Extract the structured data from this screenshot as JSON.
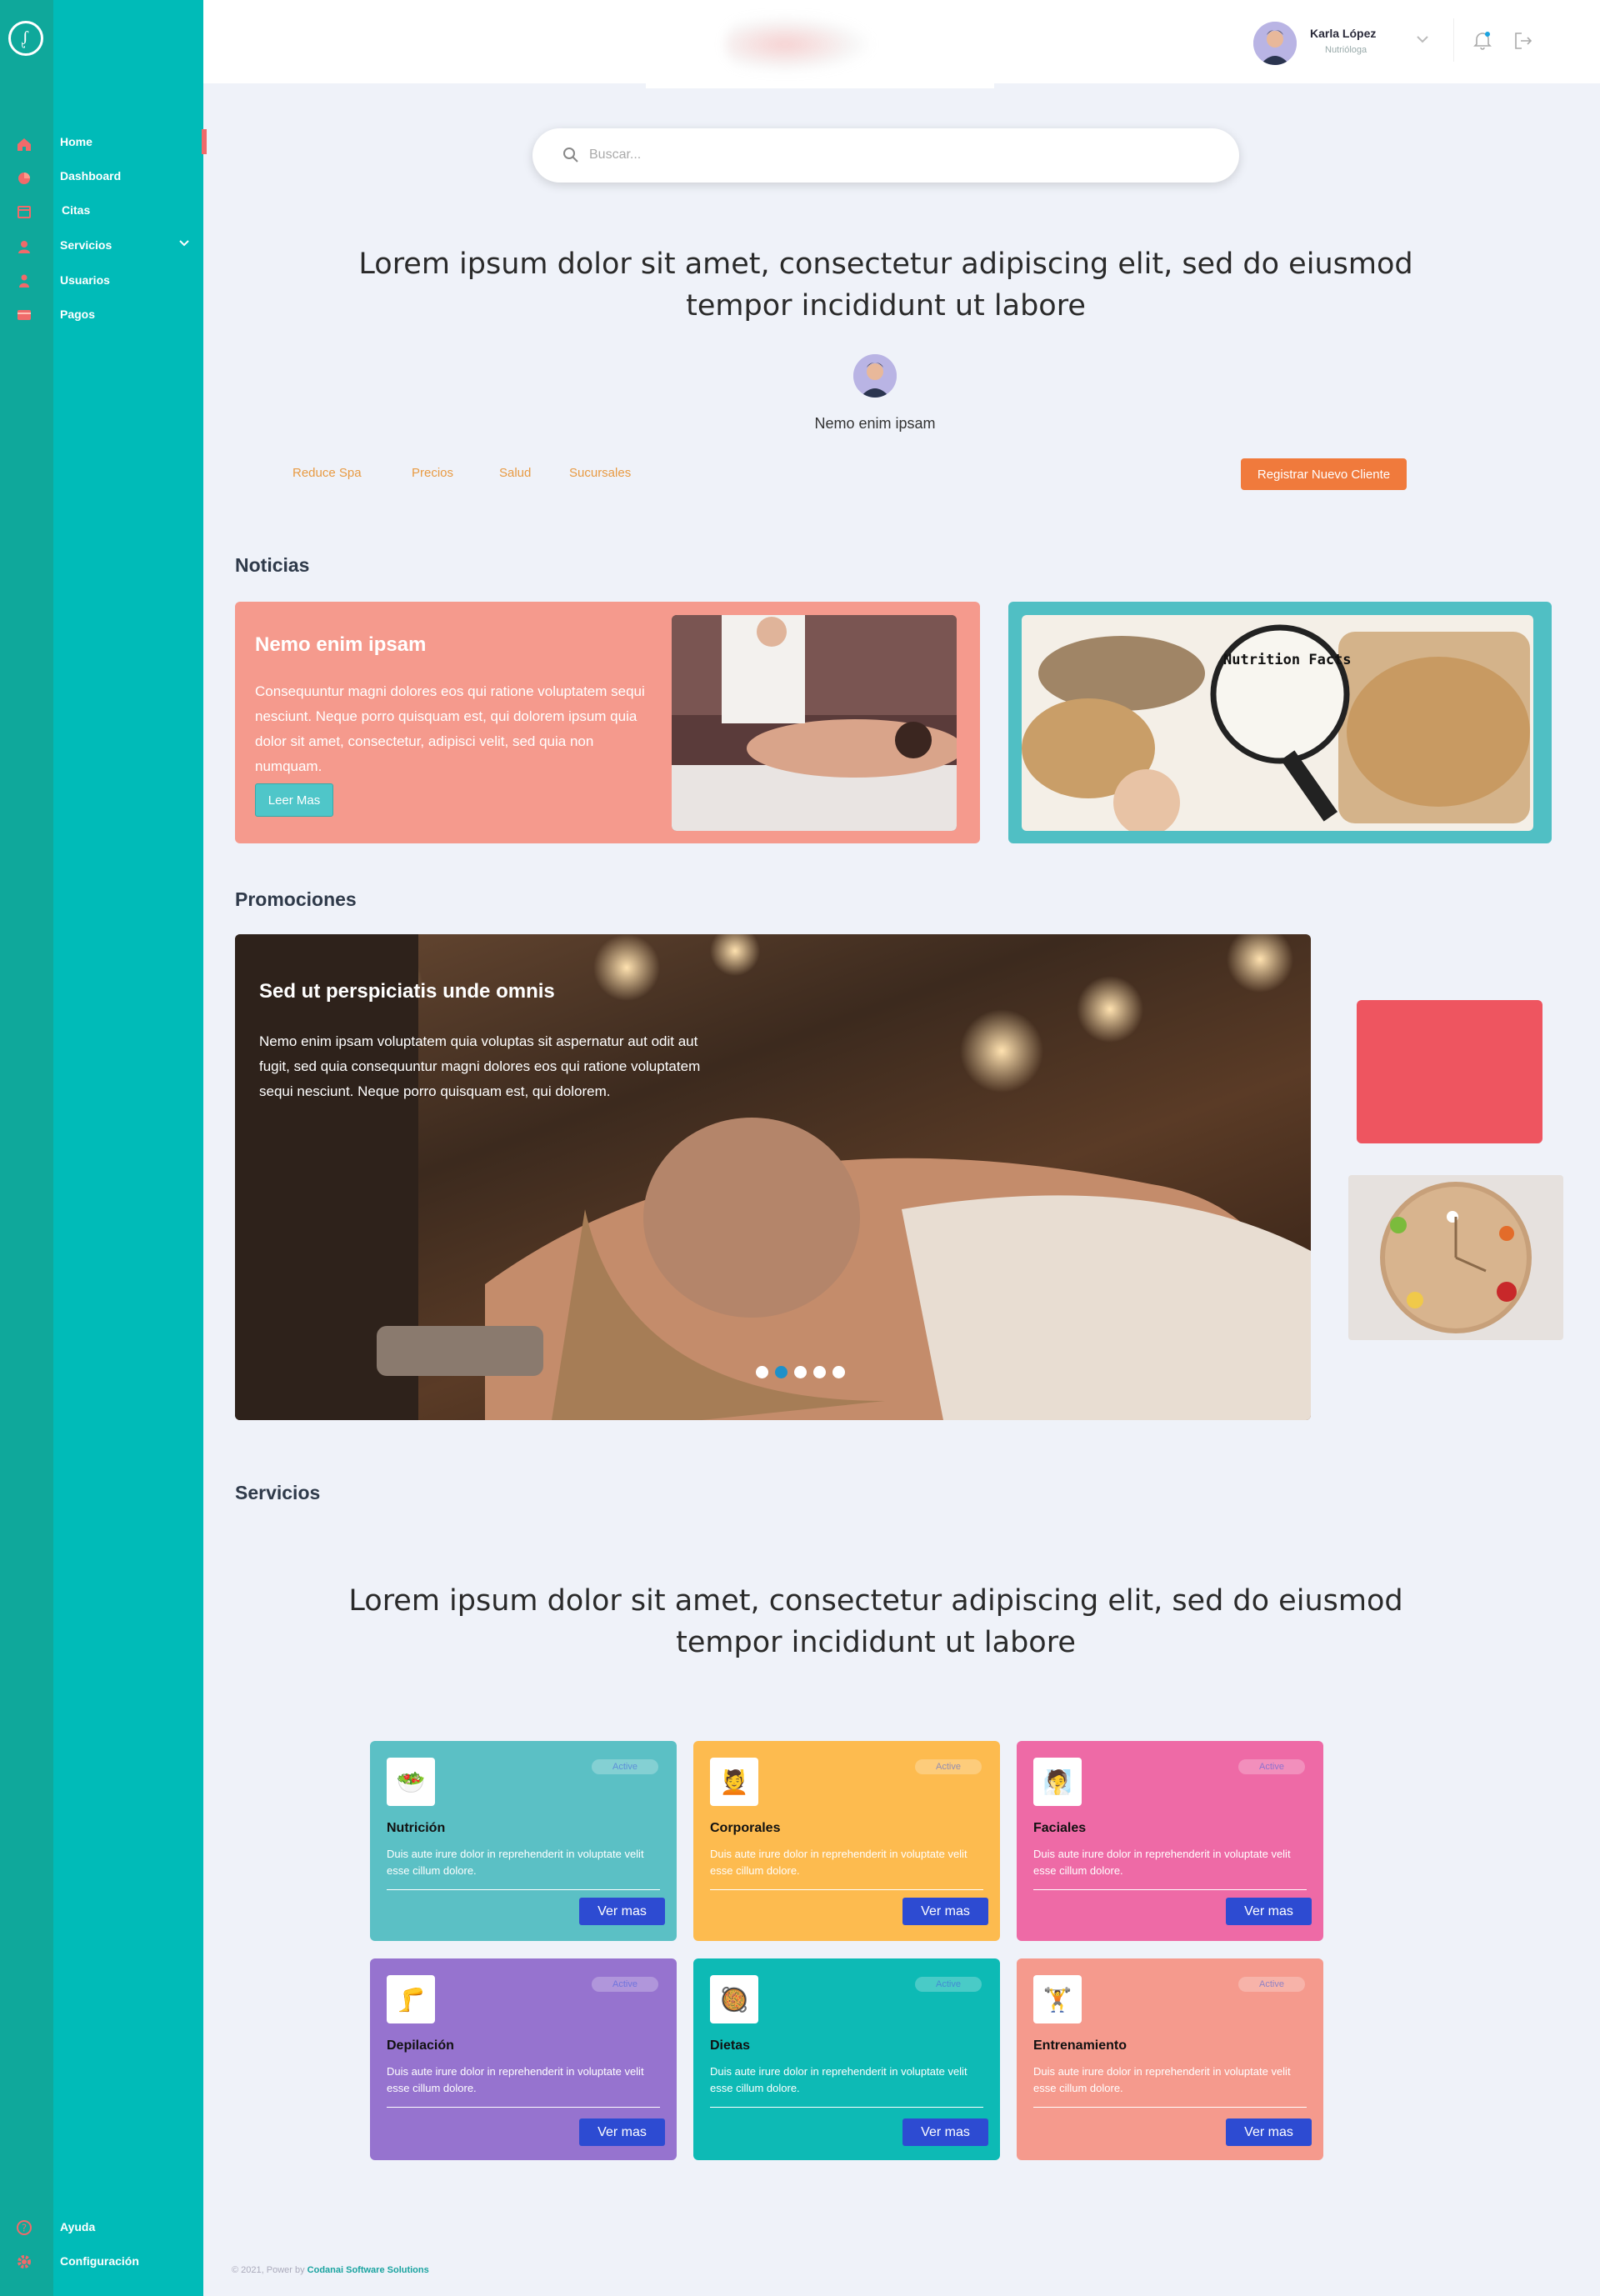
{
  "sidebar": {
    "items": [
      {
        "label": "Home",
        "icon": "home-icon",
        "color": "#f06a6a"
      },
      {
        "label": "Dashboard",
        "icon": "chart-pie-icon",
        "color": "#f06a6a"
      },
      {
        "label": "Citas",
        "icon": "calendar-icon",
        "color": "#f06a6a"
      },
      {
        "label": "Servicios",
        "icon": "user-icon",
        "color": "#f06a6a"
      },
      {
        "label": "Usuarios",
        "icon": "users-icon",
        "color": "#f06a6a"
      },
      {
        "label": "Pagos",
        "icon": "credit-card-icon",
        "color": "#f06a6a"
      }
    ],
    "bottom": [
      {
        "label": "Ayuda",
        "icon": "help-circle-icon"
      },
      {
        "label": "Configuración",
        "icon": "gear-icon"
      }
    ],
    "accent": "#00bbb8"
  },
  "header": {
    "user_name": "Karla López",
    "user_role": "Nutrióloga"
  },
  "search": {
    "placeholder": "Buscar..."
  },
  "hero": {
    "headline": "Lorem ipsum dolor sit amet, consectetur adipiscing elit, sed do eiusmod tempor incididunt ut labore",
    "author": "Nemo enim ipsam"
  },
  "filters": [
    "Reduce Spa",
    "Precios",
    "Salud",
    "Sucursales"
  ],
  "register_button": "Registrar Nuevo Cliente",
  "news": {
    "section_title": "Noticias",
    "title": "Nemo enim ipsam",
    "body": "Consequuntur magni dolores eos qui ratione voluptatem sequi nesciunt. Neque porro quisquam est, qui dolorem ipsum quia dolor sit amet, consectetur, adipisci velit, sed quia non numquam.",
    "button": "Leer Mas",
    "nutrition_label": "Nutrition Facts"
  },
  "promo": {
    "section_title": "Promociones",
    "title": "Sed ut perspiciatis unde omnis",
    "body": "Nemo enim ipsam voluptatem quia voluptas sit aspernatur aut odit aut fugit, sed quia consequuntur magni dolores eos qui ratione voluptatem sequi nesciunt. Neque porro quisquam est, qui dolorem.",
    "slides": 5,
    "active_slide": 2
  },
  "services": {
    "section_title": "Servicios",
    "headline": "Lorem ipsum dolor sit amet, consectetur adipiscing elit, sed do eiusmod tempor incididunt ut labore",
    "cards": [
      {
        "title": "Nutrición",
        "desc": "Duis aute irure dolor in reprehenderit in voluptate velit esse cillum dolore.",
        "badge": "Active",
        "button": "Ver mas",
        "color": "#5bc0c5",
        "thumb": "🥗"
      },
      {
        "title": "Corporales",
        "desc": "Duis aute irure dolor in reprehenderit in voluptate velit esse cillum dolore.",
        "badge": "Active",
        "button": "Ver mas",
        "color": "#fdbb4f",
        "thumb": "💆"
      },
      {
        "title": "Faciales",
        "desc": "Duis aute irure dolor in reprehenderit in voluptate velit esse cillum dolore.",
        "badge": "Active",
        "button": "Ver mas",
        "color": "#ee6aa6",
        "thumb": "🧖"
      },
      {
        "title": "Depilación",
        "desc": "Duis aute irure dolor in reprehenderit in voluptate velit esse cillum dolore.",
        "badge": "Active",
        "button": "Ver mas",
        "color": "#9673cf",
        "thumb": "🦵"
      },
      {
        "title": "Dietas",
        "desc": "Duis aute irure dolor in reprehenderit in voluptate velit esse cillum dolore.",
        "badge": "Active",
        "button": "Ver mas",
        "color": "#0dbab5",
        "thumb": "🥘"
      },
      {
        "title": "Entrenamiento",
        "desc": "Duis aute irure dolor in reprehenderit in voluptate velit esse cillum dolore.",
        "badge": "Active",
        "button": "Ver mas",
        "color": "#f59a8d",
        "thumb": "🏋"
      }
    ]
  },
  "footer": {
    "prefix": "© 2021, Power by",
    "company": "Codanai Software Solutions"
  }
}
